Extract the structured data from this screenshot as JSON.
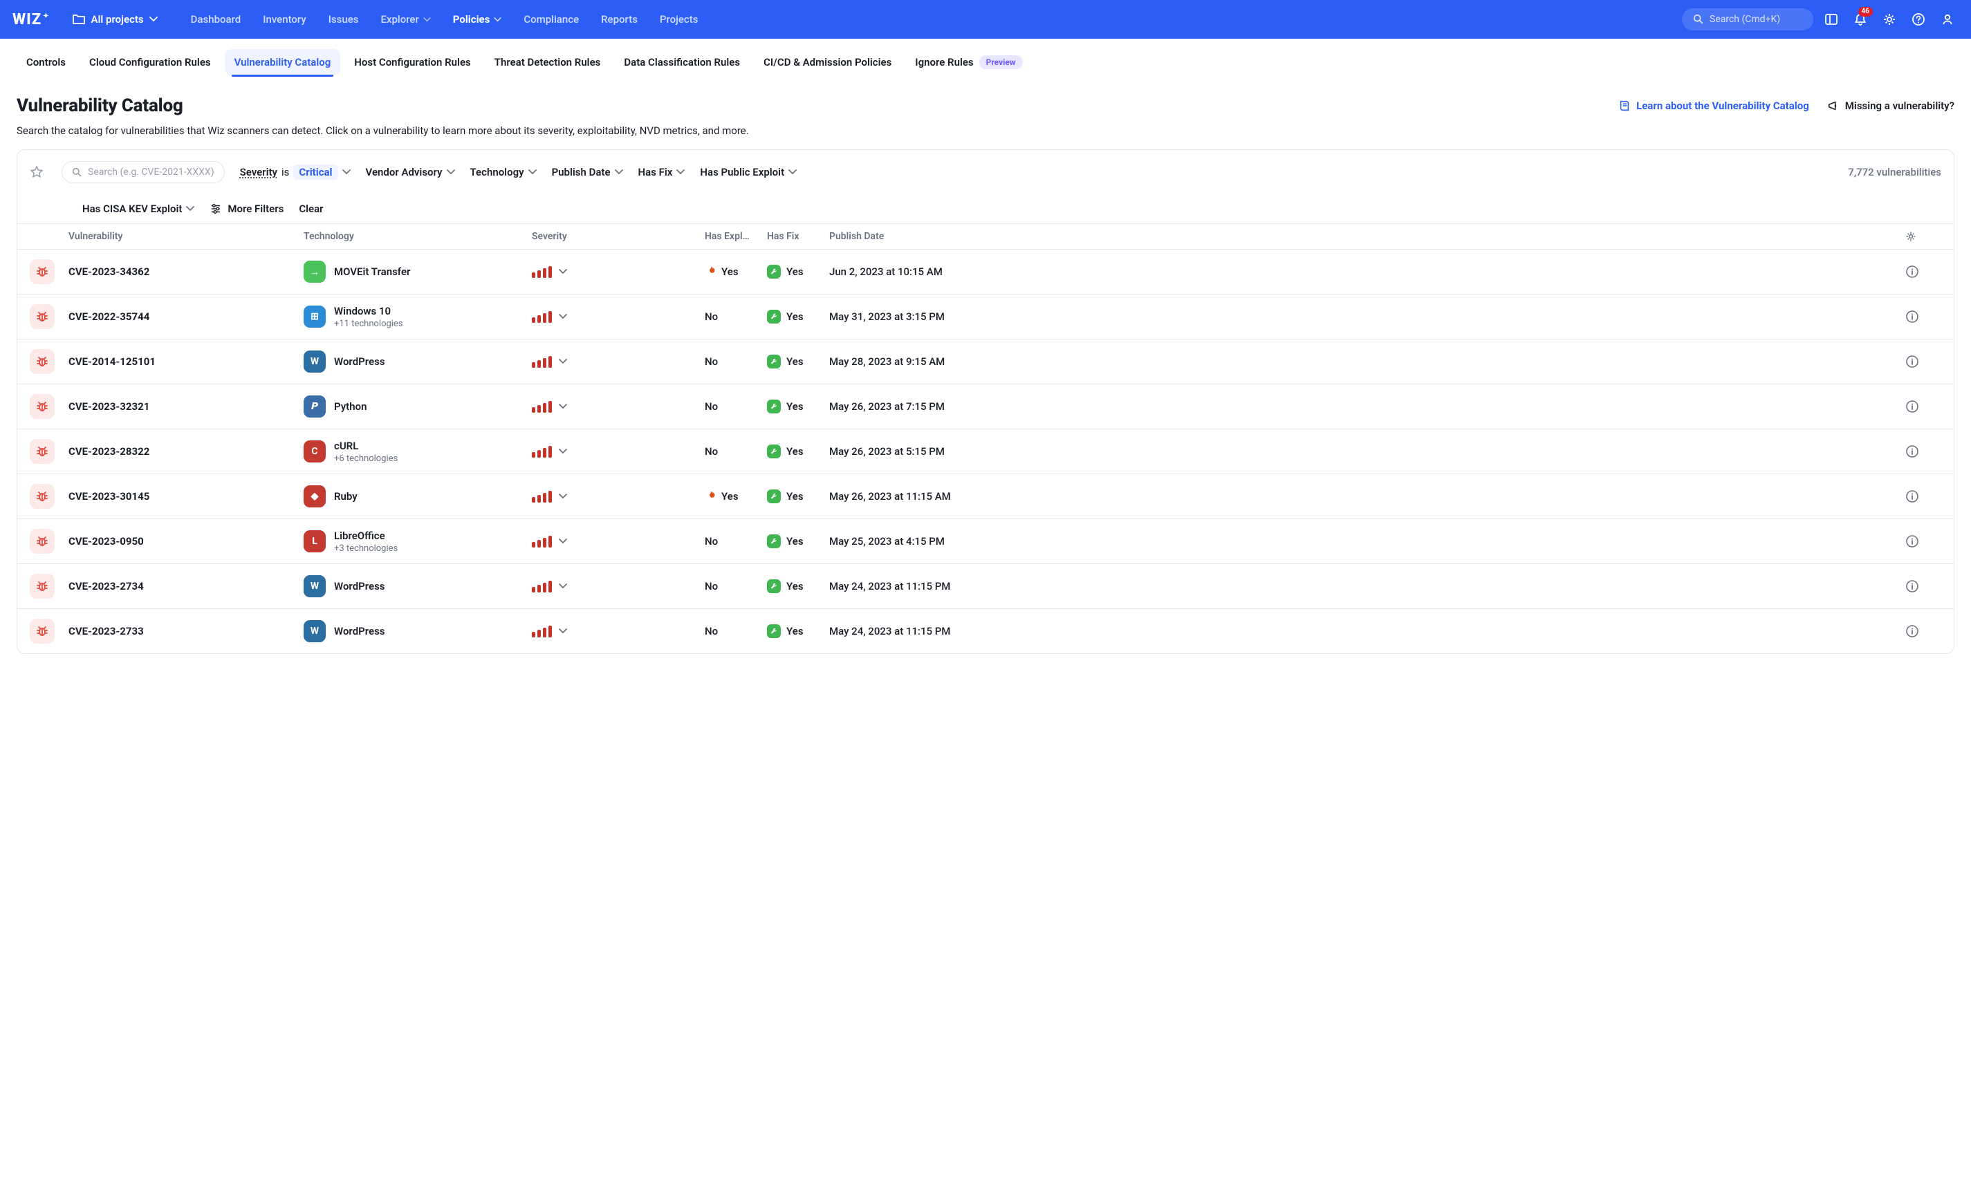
{
  "brand": "WIZ",
  "project_switcher": {
    "label": "All projects"
  },
  "top_nav": [
    {
      "label": "Dashboard",
      "active": false,
      "has_menu": false
    },
    {
      "label": "Inventory",
      "active": false,
      "has_menu": false
    },
    {
      "label": "Issues",
      "active": false,
      "has_menu": false
    },
    {
      "label": "Explorer",
      "active": false,
      "has_menu": true
    },
    {
      "label": "Policies",
      "active": true,
      "has_menu": true
    },
    {
      "label": "Compliance",
      "active": false,
      "has_menu": false
    },
    {
      "label": "Reports",
      "active": false,
      "has_menu": false
    },
    {
      "label": "Projects",
      "active": false,
      "has_menu": false
    }
  ],
  "cmdk_placeholder": "Search (Cmd+K)",
  "notif_count": "46",
  "sub_tabs": [
    {
      "label": "Controls",
      "active": false
    },
    {
      "label": "Cloud Configuration Rules",
      "active": false
    },
    {
      "label": "Vulnerability Catalog",
      "active": true
    },
    {
      "label": "Host Configuration Rules",
      "active": false
    },
    {
      "label": "Threat Detection Rules",
      "active": false
    },
    {
      "label": "Data Classification Rules",
      "active": false
    },
    {
      "label": "CI/CD & Admission Policies",
      "active": false
    },
    {
      "label": "Ignore Rules",
      "active": false,
      "badge": "Preview"
    }
  ],
  "page": {
    "title": "Vulnerability Catalog",
    "learn_link": "Learn about the Vulnerability Catalog",
    "missing_link": "Missing a vulnerability?",
    "subtitle": "Search the catalog for vulnerabilities that Wiz scanners can detect. Click on a vulnerability to learn more about its severity, exploitability, NVD metrics, and more."
  },
  "filters": {
    "search_placeholder": "Search (e.g. CVE-2021-XXXX)",
    "severity": {
      "label": "Severity",
      "is": "is",
      "value": "Critical"
    },
    "chips": [
      {
        "label": "Vendor Advisory"
      },
      {
        "label": "Technology"
      },
      {
        "label": "Publish Date"
      },
      {
        "label": "Has Fix"
      },
      {
        "label": "Has Public Exploit"
      }
    ],
    "count_label": "7,772 vulnerabilities",
    "second_row_chip": {
      "label": "Has CISA KEV Exploit"
    },
    "more_filters": "More Filters",
    "clear": "Clear"
  },
  "columns": {
    "vuln": "Vulnerability",
    "tech": "Technology",
    "sev": "Severity",
    "expl": "Has Expl…",
    "fix": "Has Fix",
    "date": "Publish Date"
  },
  "tech_colors": {
    "moveit": "#4cc25a",
    "windows": "#2a8cd6",
    "wordpress": "#2b6ea1",
    "python": "#3b6ea8",
    "curl": "#c53a30",
    "ruby": "#c53a30",
    "libre": "#c53a30"
  },
  "rows": [
    {
      "id": "CVE-2023-34362",
      "tech": "MOVEit Transfer",
      "sub": "",
      "icon": "moveit",
      "glyph": "→",
      "exploit": "Yes",
      "fix": "Yes",
      "date": "Jun 2, 2023 at 10:15 AM"
    },
    {
      "id": "CVE-2022-35744",
      "tech": "Windows 10",
      "sub": "+11 technologies",
      "icon": "windows",
      "glyph": "⊞",
      "exploit": "No",
      "fix": "Yes",
      "date": "May 31, 2023 at 3:15 PM"
    },
    {
      "id": "CVE-2014-125101",
      "tech": "WordPress",
      "sub": "",
      "icon": "wordpress",
      "glyph": "W",
      "exploit": "No",
      "fix": "Yes",
      "date": "May 28, 2023 at 9:15 AM"
    },
    {
      "id": "CVE-2023-32321",
      "tech": "Python",
      "sub": "",
      "icon": "python",
      "glyph": "𝙋",
      "exploit": "No",
      "fix": "Yes",
      "date": "May 26, 2023 at 7:15 PM"
    },
    {
      "id": "CVE-2023-28322",
      "tech": "cURL",
      "sub": "+6 technologies",
      "icon": "curl",
      "glyph": "C",
      "exploit": "No",
      "fix": "Yes",
      "date": "May 26, 2023 at 5:15 PM"
    },
    {
      "id": "CVE-2023-30145",
      "tech": "Ruby",
      "sub": "",
      "icon": "ruby",
      "glyph": "◆",
      "exploit": "Yes",
      "fix": "Yes",
      "date": "May 26, 2023 at 11:15 AM"
    },
    {
      "id": "CVE-2023-0950",
      "tech": "LibreOffice",
      "sub": "+3 technologies",
      "icon": "libre",
      "glyph": "L",
      "exploit": "No",
      "fix": "Yes",
      "date": "May 25, 2023 at 4:15 PM"
    },
    {
      "id": "CVE-2023-2734",
      "tech": "WordPress",
      "sub": "",
      "icon": "wordpress",
      "glyph": "W",
      "exploit": "No",
      "fix": "Yes",
      "date": "May 24, 2023 at 11:15 PM"
    },
    {
      "id": "CVE-2023-2733",
      "tech": "WordPress",
      "sub": "",
      "icon": "wordpress",
      "glyph": "W",
      "exploit": "No",
      "fix": "Yes",
      "date": "May 24, 2023 at 11:15 PM"
    }
  ]
}
